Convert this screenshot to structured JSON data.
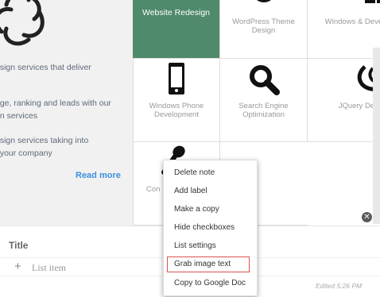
{
  "intro": {
    "text1": "esign services that deliver",
    "text2": "age, ranking and leads with our\ngn services",
    "text3": "esign services taking into\nf your company",
    "read_more": "Read more"
  },
  "services": [
    {
      "label": "Website Redesign",
      "icon": "rotate-icon",
      "active": true
    },
    {
      "label": "WordPress Theme Design",
      "icon": "wordpress-icon",
      "active": false
    },
    {
      "label": "Windows & Developme",
      "icon": "windows-icon",
      "active": false
    },
    {
      "label": "Windows Phone Development",
      "icon": "phone-icon",
      "active": false
    },
    {
      "label": "Search Engine Optimization",
      "icon": "magnifier-icon",
      "active": false
    },
    {
      "label": "JQuery Developme",
      "icon": "jquery-icon",
      "active": false
    },
    {
      "label": "Con",
      "icon": "microphone-icon",
      "active": false
    }
  ],
  "note": {
    "title": "Title",
    "list_item_placeholder": "List item",
    "edited": "Edited 5:26 PM"
  },
  "menu": {
    "items": [
      {
        "label": "Delete note"
      },
      {
        "label": "Add label"
      },
      {
        "label": "Make a copy"
      },
      {
        "label": "Hide checkboxes"
      },
      {
        "label": "List settings"
      },
      {
        "label": "Grab image text",
        "highlighted": true
      },
      {
        "label": "Copy to Google Doc"
      }
    ],
    "highlight_color": "#d9534f"
  },
  "colors": {
    "accent": "#4f8a6a",
    "link": "#3d8fe0"
  }
}
